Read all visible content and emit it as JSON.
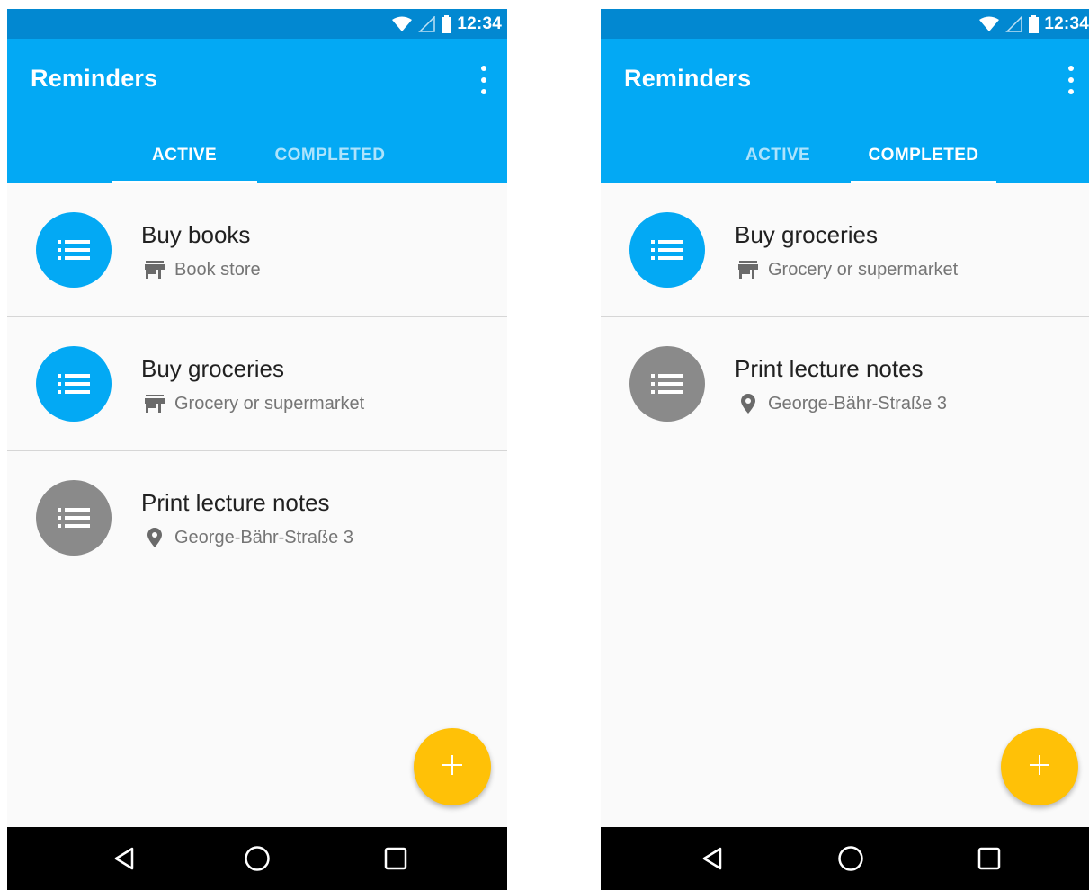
{
  "screens": [
    {
      "id": "left",
      "status": {
        "time": "12:34"
      },
      "app": {
        "title": "Reminders"
      },
      "tabs": [
        {
          "label": "ACTIVE",
          "selected": true
        },
        {
          "label": "COMPLETED",
          "selected": false
        }
      ],
      "items": [
        {
          "title": "Buy books",
          "subtitle": "Book store",
          "sub_icon": "store-icon",
          "avatar_color": "#03a9f4"
        },
        {
          "title": "Buy groceries",
          "subtitle": "Grocery or supermarket",
          "sub_icon": "store-icon",
          "avatar_color": "#03a9f4"
        },
        {
          "title": "Print lecture notes",
          "subtitle": "George-Bähr-Straße 3",
          "sub_icon": "location-pin-icon",
          "avatar_color": "#8a8a8a"
        }
      ],
      "fab": {
        "icon": "plus-icon",
        "color": "#ffc107"
      },
      "nav": [
        "back-icon",
        "home-icon",
        "recents-icon"
      ]
    },
    {
      "id": "right",
      "status": {
        "time": "12:34"
      },
      "app": {
        "title": "Reminders"
      },
      "tabs": [
        {
          "label": "ACTIVE",
          "selected": false
        },
        {
          "label": "COMPLETED",
          "selected": true
        }
      ],
      "items": [
        {
          "title": "Buy groceries",
          "subtitle": "Grocery or supermarket",
          "sub_icon": "store-icon",
          "avatar_color": "#03a9f4"
        },
        {
          "title": "Print lecture notes",
          "subtitle": "George-Bähr-Straße 3",
          "sub_icon": "location-pin-icon",
          "avatar_color": "#8a8a8a"
        }
      ],
      "fab": {
        "icon": "plus-icon",
        "color": "#ffc107"
      },
      "nav": [
        "back-icon",
        "home-icon",
        "recents-icon"
      ]
    }
  ],
  "colors": {
    "status_bar": "#0288d1",
    "app_bar": "#03a9f4",
    "fab": "#ffc107",
    "avatar_active": "#03a9f4",
    "avatar_inactive": "#8a8a8a"
  }
}
